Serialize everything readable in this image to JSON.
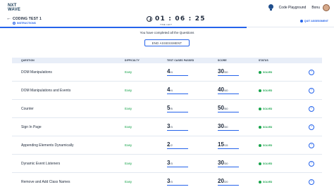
{
  "topnav": {
    "logo_line1": "NXT",
    "logo_line2": "WAVE",
    "playground_label": "Code Playground",
    "user_name": "Bonu"
  },
  "header": {
    "back_glyph": "←",
    "title": "CODING TEST 1",
    "instructions_label": "INSTRUCTIONS",
    "timer": "01 : 06 : 25",
    "time_left_label": "TIME LEFT",
    "quit_label": "QUIT ASSESSMENT"
  },
  "main": {
    "completion_message": "You have completed all the Questions",
    "end_button_label": "END ASSESSMENT"
  },
  "table": {
    "headers": [
      "QUESTION",
      "DIFFICULTY",
      "TEST CASES PASSED",
      "SCORE",
      "STATUS"
    ],
    "rows": [
      {
        "question": "DOM Manipulations",
        "difficulty": "Easy",
        "passed": "4",
        "total": "/4",
        "score": "30",
        "max": "/30",
        "status": "SOLVED"
      },
      {
        "question": "DOM Manipulations and Events",
        "difficulty": "Easy",
        "passed": "4",
        "total": "/4",
        "score": "40",
        "max": "/40",
        "status": "SOLVED"
      },
      {
        "question": "Counter",
        "difficulty": "Easy",
        "passed": "5",
        "total": "/5",
        "score": "50",
        "max": "/50",
        "status": "SOLVED"
      },
      {
        "question": "Sign In Page",
        "difficulty": "Easy",
        "passed": "3",
        "total": "/3",
        "score": "30",
        "max": "/30",
        "status": "SOLVED"
      },
      {
        "question": "Appending Elements Dynamically",
        "difficulty": "Easy",
        "passed": "2",
        "total": "/2",
        "score": "15",
        "max": "/15",
        "status": "SOLVED"
      },
      {
        "question": "Dynamic Event Listeners",
        "difficulty": "Easy",
        "passed": "3",
        "total": "/3",
        "score": "30",
        "max": "/30",
        "status": "SOLVED"
      },
      {
        "question": "Remove and Add Class Names",
        "difficulty": "Easy",
        "passed": "3",
        "total": "/3",
        "score": "20",
        "max": "/20",
        "status": "SOLVED"
      }
    ]
  },
  "colors": {
    "accent": "#2563eb",
    "success": "#16a34a",
    "header_bg": "#e8eef8"
  }
}
